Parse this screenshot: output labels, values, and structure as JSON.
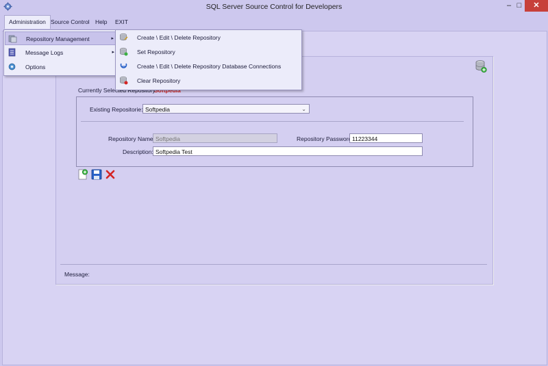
{
  "window": {
    "title": "SQL Server Source Control for Developers",
    "minimize": "–",
    "maximize": "□",
    "close": "✕"
  },
  "menubar": {
    "items": [
      "Administration",
      "Source Control",
      "Help",
      "EXIT"
    ]
  },
  "admin_menu": {
    "items": [
      {
        "label": "Repository Management",
        "icon": "repo-mgmt-icon",
        "has_submenu": true
      },
      {
        "label": "Message Logs",
        "icon": "logs-icon",
        "has_submenu": true
      },
      {
        "label": "Options",
        "icon": "options-icon",
        "has_submenu": false
      }
    ]
  },
  "repo_submenu": {
    "items": [
      {
        "label": "Create \\ Edit \\ Delete Repository",
        "icon": "repo-edit-icon"
      },
      {
        "label": "Set Repository",
        "icon": "set-repo-icon"
      },
      {
        "label": "Create \\ Edit \\ Delete Repository Database Connections",
        "icon": "db-connection-icon"
      },
      {
        "label": "Clear Repository",
        "icon": "clear-repo-icon"
      }
    ]
  },
  "form": {
    "current_label": "Currently Selected Repository:",
    "current_value": "Softpedia",
    "existing_label": "Existing Repositorie:",
    "existing_value": "Softpedia",
    "name_label": "Repository Name:",
    "name_value": "Softpedia",
    "password_label": "Repository Password:",
    "password_value": "11223344",
    "description_label": "Description:",
    "description_value": "Softpedia Test"
  },
  "message": {
    "label": "Message:"
  },
  "colors": {
    "background": "#cdc8ee",
    "close_button": "#c7403a",
    "current_value": "#d02020"
  }
}
